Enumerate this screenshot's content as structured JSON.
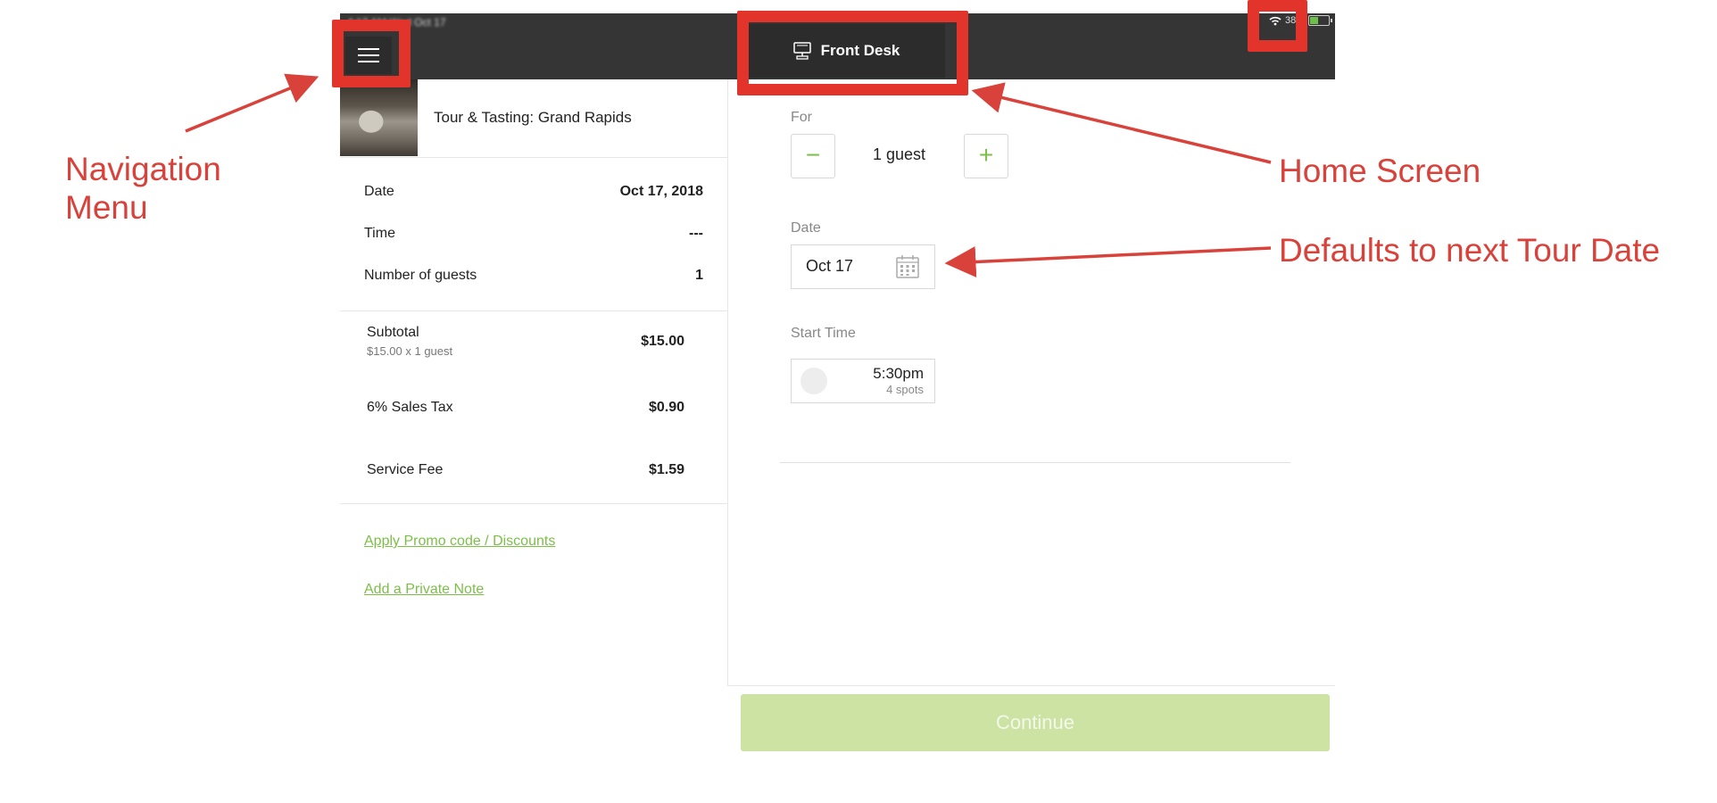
{
  "status_bar": {
    "time": "4:17 AM Wed Oct 17",
    "battery": "38%"
  },
  "header": {
    "title": "Front Desk",
    "menu_icon": "hamburger-icon",
    "desk_icon": "kiosk-icon"
  },
  "summary": {
    "tour_title": "Tour & Tasting: Grand Rapids",
    "details": [
      {
        "label": "Date",
        "value": "Oct 17, 2018"
      },
      {
        "label": "Time",
        "value": "---"
      },
      {
        "label": "Number of guests",
        "value": "1"
      }
    ],
    "subtotal": {
      "label": "Subtotal",
      "detail": "$15.00 x 1 guest",
      "value": "$15.00"
    },
    "tax": {
      "label": "6% Sales Tax",
      "value": "$0.90"
    },
    "fee": {
      "label": "Service Fee",
      "value": "$1.59"
    },
    "promo_link": "Apply Promo code / Discounts",
    "note_link": "Add a Private Note"
  },
  "booking": {
    "for_label": "For",
    "guests_text": "1 guest",
    "minus_symbol": "−",
    "plus_symbol": "+",
    "date_label": "Date",
    "date_value": "Oct 17",
    "start_time_label": "Start Time",
    "slot_time": "5:30pm",
    "slot_spots": "4 spots",
    "continue_label": "Continue"
  },
  "annotations": {
    "nav_menu": "Navigation Menu",
    "home_screen": "Home Screen",
    "defaults": "Defaults to next Tour Date",
    "color": "#e2342b"
  }
}
